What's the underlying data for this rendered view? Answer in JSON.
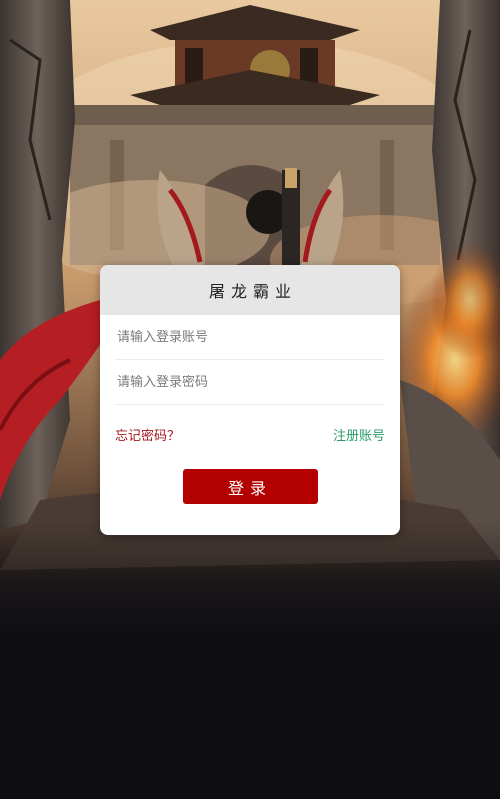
{
  "login": {
    "title": "屠龙霸业",
    "account_placeholder": "请输入登录账号",
    "password_placeholder": "请输入登录密码",
    "forgot_password": "忘记密码？",
    "register": "注册账号",
    "submit": "登录"
  },
  "colors": {
    "brand_red": "#b30000",
    "link_red": "#a3191e",
    "link_green": "#2a9a6b",
    "header_gray": "#e6e6e6"
  }
}
